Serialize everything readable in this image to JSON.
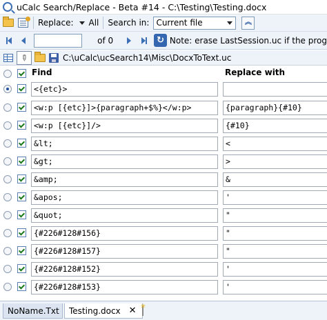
{
  "window": {
    "title": "uCalc Search/Replace - Beta #14 - C:\\Testing\\Testing.docx"
  },
  "toolbar1": {
    "replace_label": "Replace:",
    "replace_scope": "All",
    "search_in_label": "Search in:",
    "search_in_value": "Current file"
  },
  "toolbar2": {
    "page_value": "",
    "of_label": "of 0",
    "note": "Note: erase LastSession.uc if the prog"
  },
  "tabrow": {
    "path": "C:\\uCalc\\ucSearch14\\Misc\\DocxToText.uc"
  },
  "grid": {
    "find_header": "Find",
    "replace_header": "Replace with",
    "rows": [
      {
        "find": "",
        "replace": ""
      },
      {
        "find": "<{etc}>",
        "replace": ""
      },
      {
        "find": "<w:p [{etc}]>{paragraph+$%}</w:p>",
        "replace": "{paragraph}{#10}"
      },
      {
        "find": "<w:p [{etc}]/>",
        "replace": "{#10}"
      },
      {
        "find": "&lt;",
        "replace": "<"
      },
      {
        "find": "&gt;",
        "replace": ">"
      },
      {
        "find": "&amp;",
        "replace": "&"
      },
      {
        "find": "&apos;",
        "replace": "'"
      },
      {
        "find": "&quot;",
        "replace": "\""
      },
      {
        "find": "{#226#128#156}",
        "replace": "\""
      },
      {
        "find": "{#226#128#157}",
        "replace": "\""
      },
      {
        "find": "{#226#128#152}",
        "replace": "'"
      },
      {
        "find": "{#226#128#153}",
        "replace": "'"
      }
    ]
  },
  "bottom_tabs": [
    {
      "label": "NoName.Txt"
    },
    {
      "label": "Testing.docx"
    }
  ],
  "colors": {
    "accent": "#3c6fb4",
    "toolbar_bg": "#eef3fa"
  }
}
